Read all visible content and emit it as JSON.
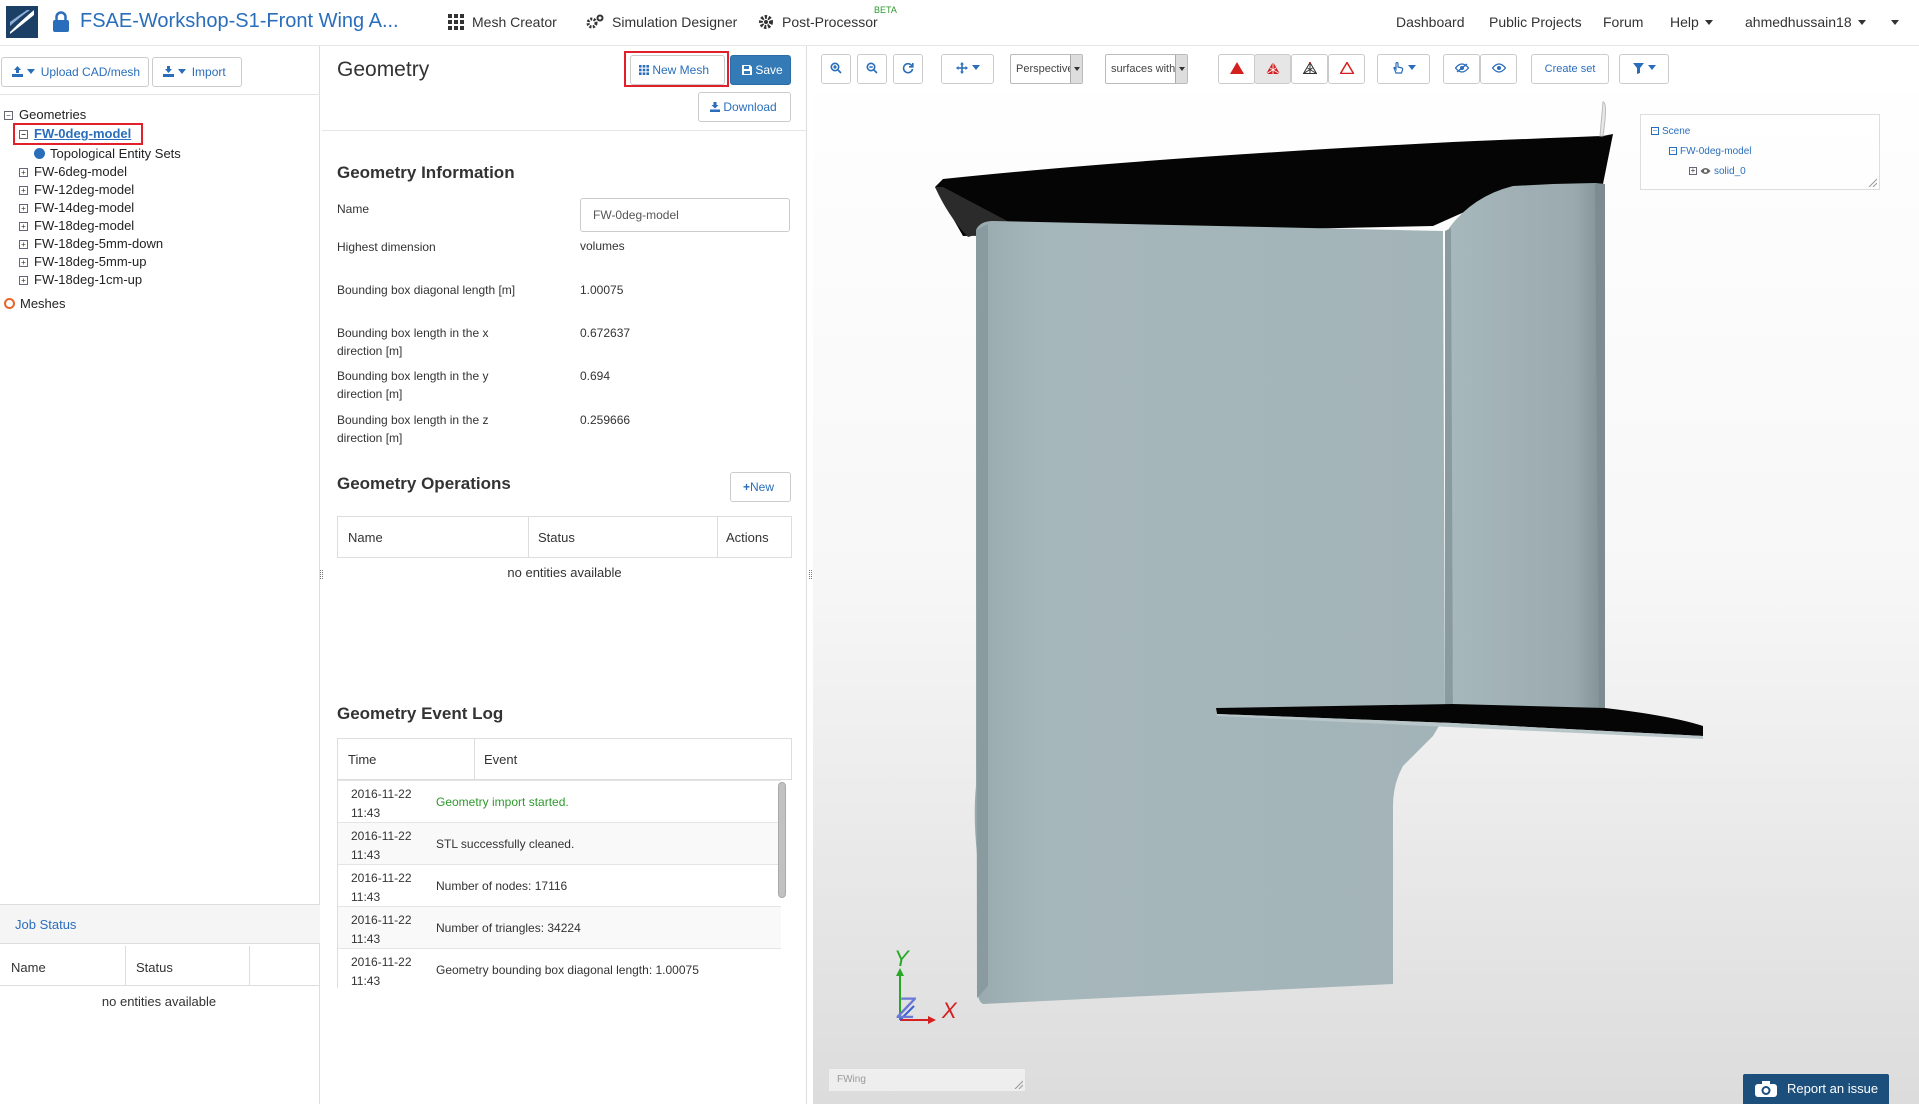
{
  "app": {
    "title": "FSAE-Workshop-S1-Front Wing A...",
    "nav": {
      "mesh_creator": "Mesh Creator",
      "simulation_designer": "Simulation Designer",
      "post_processor": "Post-Processor",
      "beta": "BETA",
      "dashboard": "Dashboard",
      "public_projects": "Public Projects",
      "forum": "Forum",
      "help": "Help",
      "user": "ahmedhussain18"
    }
  },
  "left": {
    "upload_btn": "Upload CAD/mesh",
    "import_btn": "Import",
    "tree_root": "Geometries",
    "selected_geometry": "FW-0deg-model",
    "topo_sets": "Topological Entity Sets",
    "geometries": [
      "FW-6deg-model",
      "FW-12deg-model",
      "FW-14deg-model",
      "FW-18deg-model",
      "FW-18deg-5mm-down",
      "FW-18deg-5mm-up",
      "FW-18deg-1cm-up"
    ],
    "meshes": "Meshes",
    "job_status": {
      "title": "Job Status",
      "col_name": "Name",
      "col_status": "Status",
      "empty": "no entities available"
    }
  },
  "geometry": {
    "title": "Geometry",
    "new_mesh_btn": "New Mesh",
    "save_btn": "Save",
    "download_btn": "Download",
    "info_title": "Geometry Information",
    "name_label": "Name",
    "name_value": "FW-0deg-model",
    "highest_dim_label": "Highest dimension",
    "highest_dim_value": "volumes",
    "bbox_diag_label": "Bounding box diagonal length [m]",
    "bbox_diag_value": "1.00075",
    "bbox_x_label": "Bounding box length in the x direction [m]",
    "bbox_x_value": "0.672637",
    "bbox_y_label": "Bounding box length in the y direction [m]",
    "bbox_y_value": "0.694",
    "bbox_z_label": "Bounding box length in the z direction [m]",
    "bbox_z_value": "0.259666",
    "ops_title": "Geometry Operations",
    "ops_new_btn": "New",
    "ops_cols": {
      "name": "Name",
      "status": "Status",
      "actions": "Actions"
    },
    "ops_empty": "no entities available",
    "log_title": "Geometry Event Log",
    "log_cols": {
      "time": "Time",
      "event": "Event"
    },
    "log": [
      {
        "date": "2016-11-22",
        "time": "11:43",
        "event": "Geometry import started."
      },
      {
        "date": "2016-11-22",
        "time": "11:43",
        "event": "STL successfully cleaned."
      },
      {
        "date": "2016-11-22",
        "time": "11:43",
        "event": "Number of nodes: 17116"
      },
      {
        "date": "2016-11-22",
        "time": "11:43",
        "event": "Number of triangles: 34224"
      },
      {
        "date": "2016-11-22",
        "time": "11:43",
        "event": "Geometry bounding box diagonal length: 1.00075"
      }
    ]
  },
  "viewer": {
    "projection": "Perspective",
    "render_mode": "surfaces with w",
    "create_set_btn": "Create set",
    "scene_tree": {
      "root": "Scene",
      "model": "FW-0deg-model",
      "solid": "solid_0"
    },
    "axes": {
      "y": "Y",
      "z": "Z",
      "x": "X"
    },
    "label_box": "FWing",
    "report_btn": "Report an issue"
  },
  "colors": {
    "accent": "#2a6ebb",
    "primary": "#337ab7",
    "highlight": "#e0212c",
    "success": "#2e9a2e",
    "model": "#a2b4b8"
  }
}
